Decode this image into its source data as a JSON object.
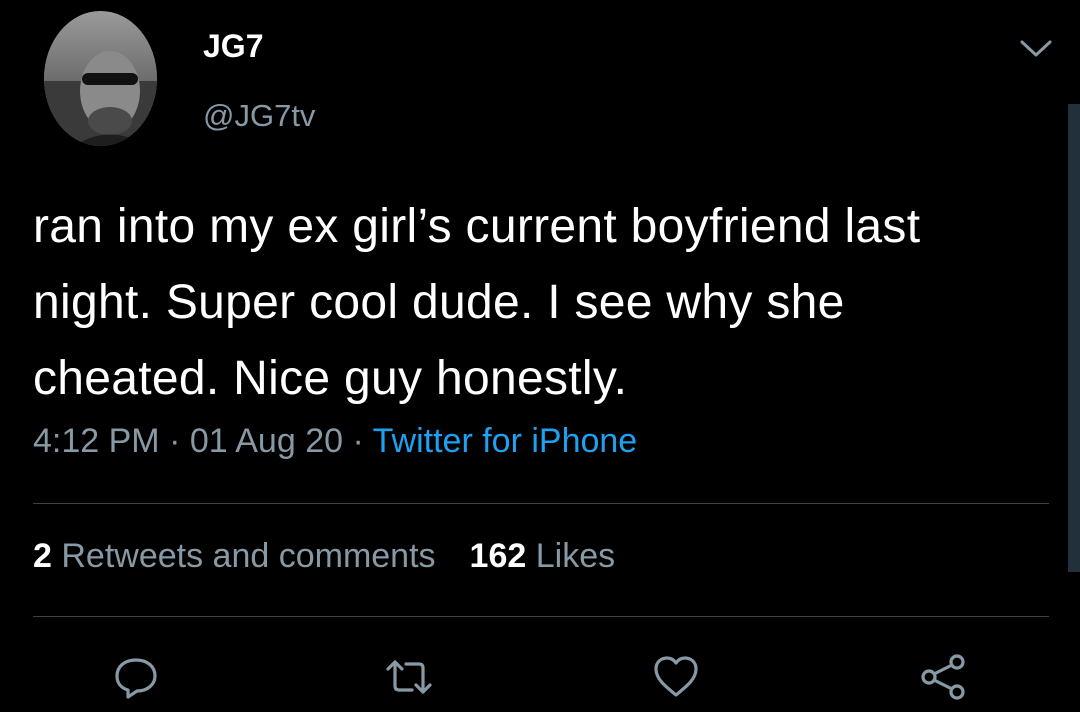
{
  "author": {
    "name": "JG7",
    "handle": "@JG7tv"
  },
  "tweet": {
    "text": "ran into my ex girl’s current boyfriend last night. Super cool dude. I see why she cheated. Nice guy honestly.",
    "time": "4:12 PM",
    "separator": "·",
    "date": "01 Aug 20",
    "source": "Twitter for iPhone"
  },
  "stats": {
    "retweets_count": "2",
    "retweets_label": "Retweets and comments",
    "likes_count": "162",
    "likes_label": "Likes"
  },
  "actions": [
    {
      "icon": "reply-icon"
    },
    {
      "icon": "retweet-icon"
    },
    {
      "icon": "like-icon"
    },
    {
      "icon": "share-icon"
    }
  ],
  "colors": {
    "background": "#000000",
    "text": "#ffffff",
    "secondary": "#8899a6",
    "link": "#1da1f2",
    "divider": "#38444d"
  }
}
